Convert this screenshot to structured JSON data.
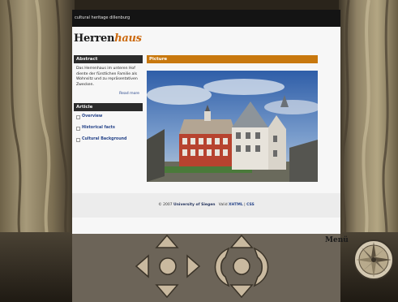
{
  "window": {
    "site_tag": "cultural heritage dillenburg"
  },
  "logo": {
    "part1": "Herren",
    "part2": "haus"
  },
  "sidebar": {
    "abstract_header": "Abstract",
    "abstract_text": "Das Herrenhaus im unteren Hof diente der fürstlichen Familie als Wohnsitz und zu repräsentativen Zwecken.",
    "read_more": "Read more",
    "article_header": "Article",
    "items": [
      {
        "label": "Overview"
      },
      {
        "label": "Historical facts"
      },
      {
        "label": "Cultural Background"
      }
    ]
  },
  "content": {
    "header": "Picture"
  },
  "footer": {
    "copyright": "© 2007",
    "org": "University of Siegen",
    "valid": "Valid",
    "xhtml": "XHTML",
    "separator": "|",
    "css": "CSS"
  },
  "controls": {
    "menu_label": "Menü"
  },
  "colors": {
    "accent": "#c8780e",
    "nav_link": "#27458a",
    "header_dark": "#2b2b2b"
  }
}
